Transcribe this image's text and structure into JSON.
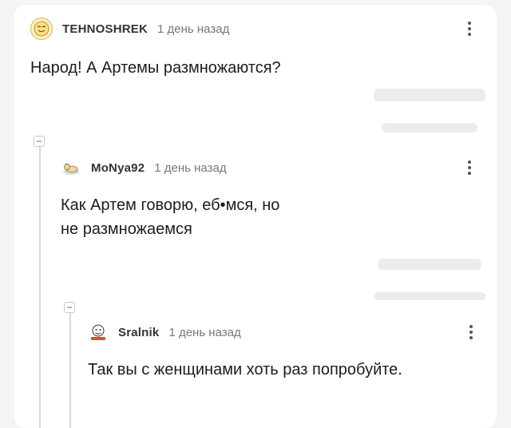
{
  "comments": [
    {
      "author": "TEHNOSHREK",
      "time": "1 день назад",
      "text": "Народ! А Артемы размножаются?",
      "avatar_icon": "smiley-face-icon"
    },
    {
      "author": "MoNya92",
      "time": "1 день назад",
      "text_line1": "Как Артем говорю, еб•мся, но",
      "text_line2": "не размножаемся",
      "avatar_icon": "sleeping-cat-icon"
    },
    {
      "author": "Sralnik",
      "time": "1 день назад",
      "text": "Так вы с женщинами хоть раз попробуйте.",
      "avatar_icon": "meme-face-icon"
    }
  ],
  "colors": {
    "background": "#f4f4f4",
    "card": "#ffffff",
    "thread": "#d7d7d7"
  }
}
